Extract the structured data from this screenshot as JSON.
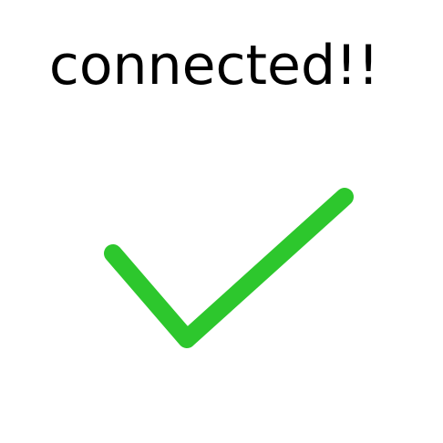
{
  "status": {
    "message": "connected!!"
  },
  "icon": {
    "name": "check-icon",
    "color": "#2DC72D"
  },
  "background": "#FFFFFF"
}
